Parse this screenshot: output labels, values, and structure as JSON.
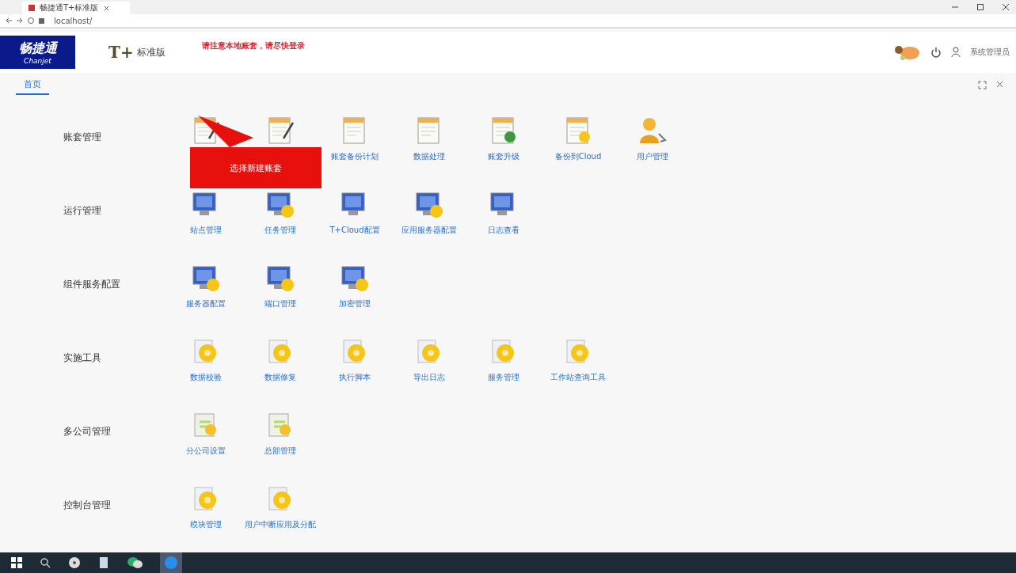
{
  "browser": {
    "tab_title": "畅捷通T+标准版",
    "address": "localhost/"
  },
  "header": {
    "logo_text": "畅捷通",
    "logo_subtext": "Chanjet",
    "product_mark": "T+",
    "product_name": "标准版",
    "notice": "请注意本地账套，请尽快登录",
    "user_name": "系统管理员"
  },
  "tabs": [
    {
      "label": "首页",
      "selected": true
    }
  ],
  "sections": [
    {
      "title": "账套管理",
      "items": [
        {
          "kind": "pen"
        },
        {
          "kind": "pen"
        },
        {
          "label": "账套备份计划"
        },
        {
          "label": "数据处理"
        },
        {
          "label": "账套升级"
        },
        {
          "label": "备份到Cloud"
        },
        {
          "label": "用户管理"
        }
      ]
    },
    {
      "title": "运行管理",
      "items": [
        {
          "label": "站点管理"
        },
        {
          "label": "任务管理"
        },
        {
          "label": "T+Cloud配置"
        },
        {
          "label": "应用服务器配置"
        },
        {
          "label": "日志查看"
        }
      ]
    },
    {
      "title": "组件服务配置",
      "items": [
        {
          "label": "服务器配置"
        },
        {
          "label": "端口管理"
        },
        {
          "label": "加密管理"
        }
      ]
    },
    {
      "title": "实施工具",
      "items": [
        {
          "label": "数据校验"
        },
        {
          "label": "数据修复"
        },
        {
          "label": "执行脚本"
        },
        {
          "label": "导出日志"
        },
        {
          "label": "服务管理"
        },
        {
          "label": "工作站查询工具"
        }
      ]
    },
    {
      "title": "多公司管理",
      "items": [
        {
          "label": "分公司设置"
        },
        {
          "label": "总部管理"
        }
      ]
    },
    {
      "title": "控制台管理",
      "items": [
        {
          "label": "模块管理"
        },
        {
          "label": "用户中断应用及分配"
        }
      ]
    }
  ],
  "callout": {
    "text": "选择新建账套"
  }
}
